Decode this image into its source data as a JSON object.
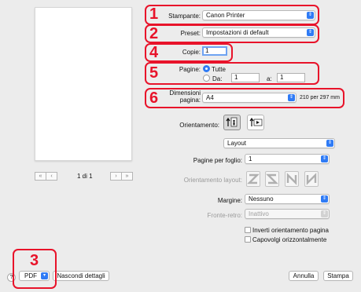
{
  "preview": {
    "page_counter": "1 di 1",
    "nav": [
      "«",
      "‹",
      "›",
      "»"
    ]
  },
  "printer": {
    "label": "Stampante:",
    "value": "Canon Printer"
  },
  "preset": {
    "label": "Preset:",
    "value": "Impostazioni di default"
  },
  "copies": {
    "label": "Copie:",
    "value": "1"
  },
  "pages": {
    "label": "Pagine:",
    "all_label": "Tutte",
    "from_label": "Da:",
    "from_value": "1",
    "to_label": "a:",
    "to_value": "1"
  },
  "paper": {
    "label_line1": "Dimensioni",
    "label_line2": "pagina:",
    "value": "A4",
    "size_text": "210 per 297 mm"
  },
  "orientation": {
    "label": "Orientamento:"
  },
  "section": {
    "value": "Layout"
  },
  "layout": {
    "pages_per_sheet_label": "Pagine per foglio:",
    "pages_per_sheet_value": "1",
    "direction_label": "Orientamento layout:",
    "border_label": "Margine:",
    "border_value": "Nessuno",
    "two_sided_label": "Fronte-retro:",
    "two_sided_value": "Inattivo",
    "reverse_label": "Inverti orientamento pagina",
    "flip_label": "Capovolgi orizzontalmente"
  },
  "footer": {
    "help": "?",
    "pdf": "PDF",
    "hide_details": "Nascondi dettagli",
    "cancel": "Annulla",
    "print": "Stampa"
  },
  "callouts": [
    "1",
    "2",
    "3",
    "4",
    "5",
    "6"
  ],
  "colors": {
    "callout": "#e8132a",
    "accent": "#2f7bf5"
  }
}
